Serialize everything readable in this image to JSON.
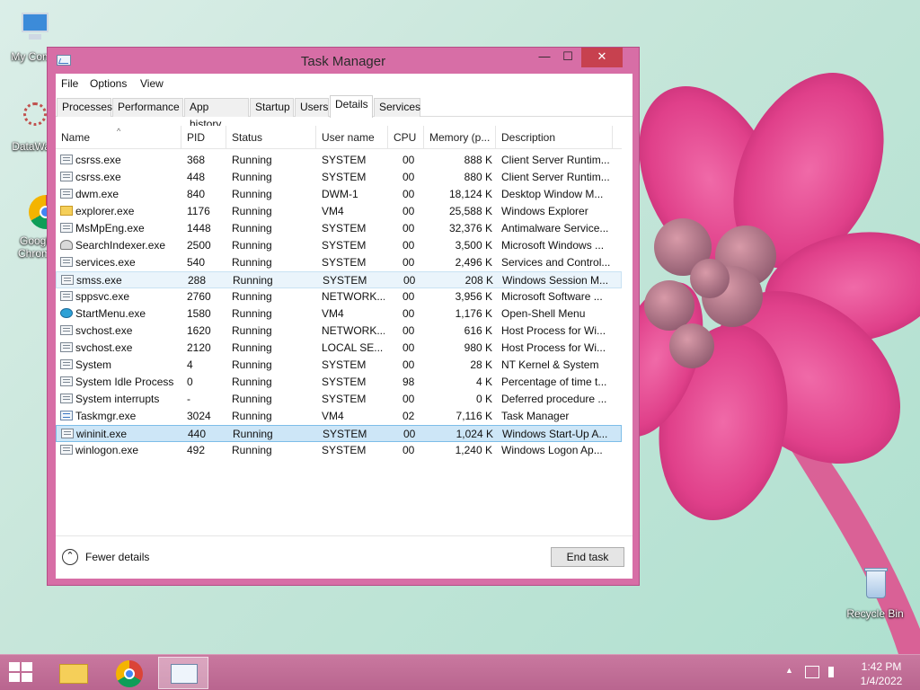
{
  "desktop": {
    "icons": [
      {
        "label": "My Comp"
      },
      {
        "label": "DataWag"
      },
      {
        "label": "Googl"
      },
      {
        "label": "Chrom"
      },
      {
        "label": "Recycle Bin"
      }
    ]
  },
  "window": {
    "title": "Task Manager",
    "minimize_glyph": "—",
    "maximize_glyph": "☐",
    "close_glyph": "✕",
    "menu": [
      "File",
      "Options",
      "View"
    ],
    "tabs": [
      "Processes",
      "Performance",
      "App history",
      "Startup",
      "Users",
      "Details",
      "Services"
    ],
    "active_tab": "Details",
    "columns": [
      "Name",
      "PID",
      "Status",
      "User name",
      "CPU",
      "Memory (p...",
      "Description"
    ],
    "rows": [
      {
        "name": "csrss.exe",
        "pid": "368",
        "status": "Running",
        "user": "SYSTEM",
        "cpu": "00",
        "mem": "888 K",
        "desc": "Client Server Runtim...",
        "icon": "window"
      },
      {
        "name": "csrss.exe",
        "pid": "448",
        "status": "Running",
        "user": "SYSTEM",
        "cpu": "00",
        "mem": "880 K",
        "desc": "Client Server Runtim...",
        "icon": "window"
      },
      {
        "name": "dwm.exe",
        "pid": "840",
        "status": "Running",
        "user": "DWM-1",
        "cpu": "00",
        "mem": "18,124 K",
        "desc": "Desktop Window M...",
        "icon": "window"
      },
      {
        "name": "explorer.exe",
        "pid": "1176",
        "status": "Running",
        "user": "VM4",
        "cpu": "00",
        "mem": "25,588 K",
        "desc": "Windows Explorer",
        "icon": "folder"
      },
      {
        "name": "MsMpEng.exe",
        "pid": "1448",
        "status": "Running",
        "user": "SYSTEM",
        "cpu": "00",
        "mem": "32,376 K",
        "desc": "Antimalware Service...",
        "icon": "window"
      },
      {
        "name": "SearchIndexer.exe",
        "pid": "2500",
        "status": "Running",
        "user": "SYSTEM",
        "cpu": "00",
        "mem": "3,500 K",
        "desc": "Microsoft Windows ...",
        "icon": "person"
      },
      {
        "name": "services.exe",
        "pid": "540",
        "status": "Running",
        "user": "SYSTEM",
        "cpu": "00",
        "mem": "2,496 K",
        "desc": "Services and Control...",
        "icon": "window"
      },
      {
        "name": "smss.exe",
        "pid": "288",
        "status": "Running",
        "user": "SYSTEM",
        "cpu": "00",
        "mem": "208 K",
        "desc": "Windows Session M...",
        "icon": "window"
      },
      {
        "name": "sppsvc.exe",
        "pid": "2760",
        "status": "Running",
        "user": "NETWORK...",
        "cpu": "00",
        "mem": "3,956 K",
        "desc": "Microsoft Software ...",
        "icon": "window"
      },
      {
        "name": "StartMenu.exe",
        "pid": "1580",
        "status": "Running",
        "user": "VM4",
        "cpu": "00",
        "mem": "1,176 K",
        "desc": "Open-Shell Menu",
        "icon": "globe"
      },
      {
        "name": "svchost.exe",
        "pid": "1620",
        "status": "Running",
        "user": "NETWORK...",
        "cpu": "00",
        "mem": "616 K",
        "desc": "Host Process for Wi...",
        "icon": "window"
      },
      {
        "name": "svchost.exe",
        "pid": "2120",
        "status": "Running",
        "user": "LOCAL SE...",
        "cpu": "00",
        "mem": "980 K",
        "desc": "Host Process for Wi...",
        "icon": "window"
      },
      {
        "name": "System",
        "pid": "4",
        "status": "Running",
        "user": "SYSTEM",
        "cpu": "00",
        "mem": "28 K",
        "desc": "NT Kernel & System",
        "icon": "window"
      },
      {
        "name": "System Idle Process",
        "pid": "0",
        "status": "Running",
        "user": "SYSTEM",
        "cpu": "98",
        "mem": "4 K",
        "desc": "Percentage of time t...",
        "icon": "window"
      },
      {
        "name": "System interrupts",
        "pid": "-",
        "status": "Running",
        "user": "SYSTEM",
        "cpu": "00",
        "mem": "0 K",
        "desc": "Deferred procedure ...",
        "icon": "window"
      },
      {
        "name": "Taskmgr.exe",
        "pid": "3024",
        "status": "Running",
        "user": "VM4",
        "cpu": "02",
        "mem": "7,116 K",
        "desc": "Task Manager",
        "icon": "chart"
      },
      {
        "name": "wininit.exe",
        "pid": "440",
        "status": "Running",
        "user": "SYSTEM",
        "cpu": "00",
        "mem": "1,024 K",
        "desc": "Windows Start-Up A...",
        "icon": "window"
      },
      {
        "name": "winlogon.exe",
        "pid": "492",
        "status": "Running",
        "user": "SYSTEM",
        "cpu": "00",
        "mem": "1,240 K",
        "desc": "Windows Logon Ap...",
        "icon": "window"
      }
    ],
    "hover_row": "smss.exe",
    "selected_row": "wininit.exe",
    "fewer_details_glyph": "⌃",
    "fewer_details": "Fewer details",
    "end_task": "End task"
  },
  "taskbar": {
    "time": "1:42 PM",
    "date": "1/4/2022",
    "tray_arrow": "▲"
  }
}
